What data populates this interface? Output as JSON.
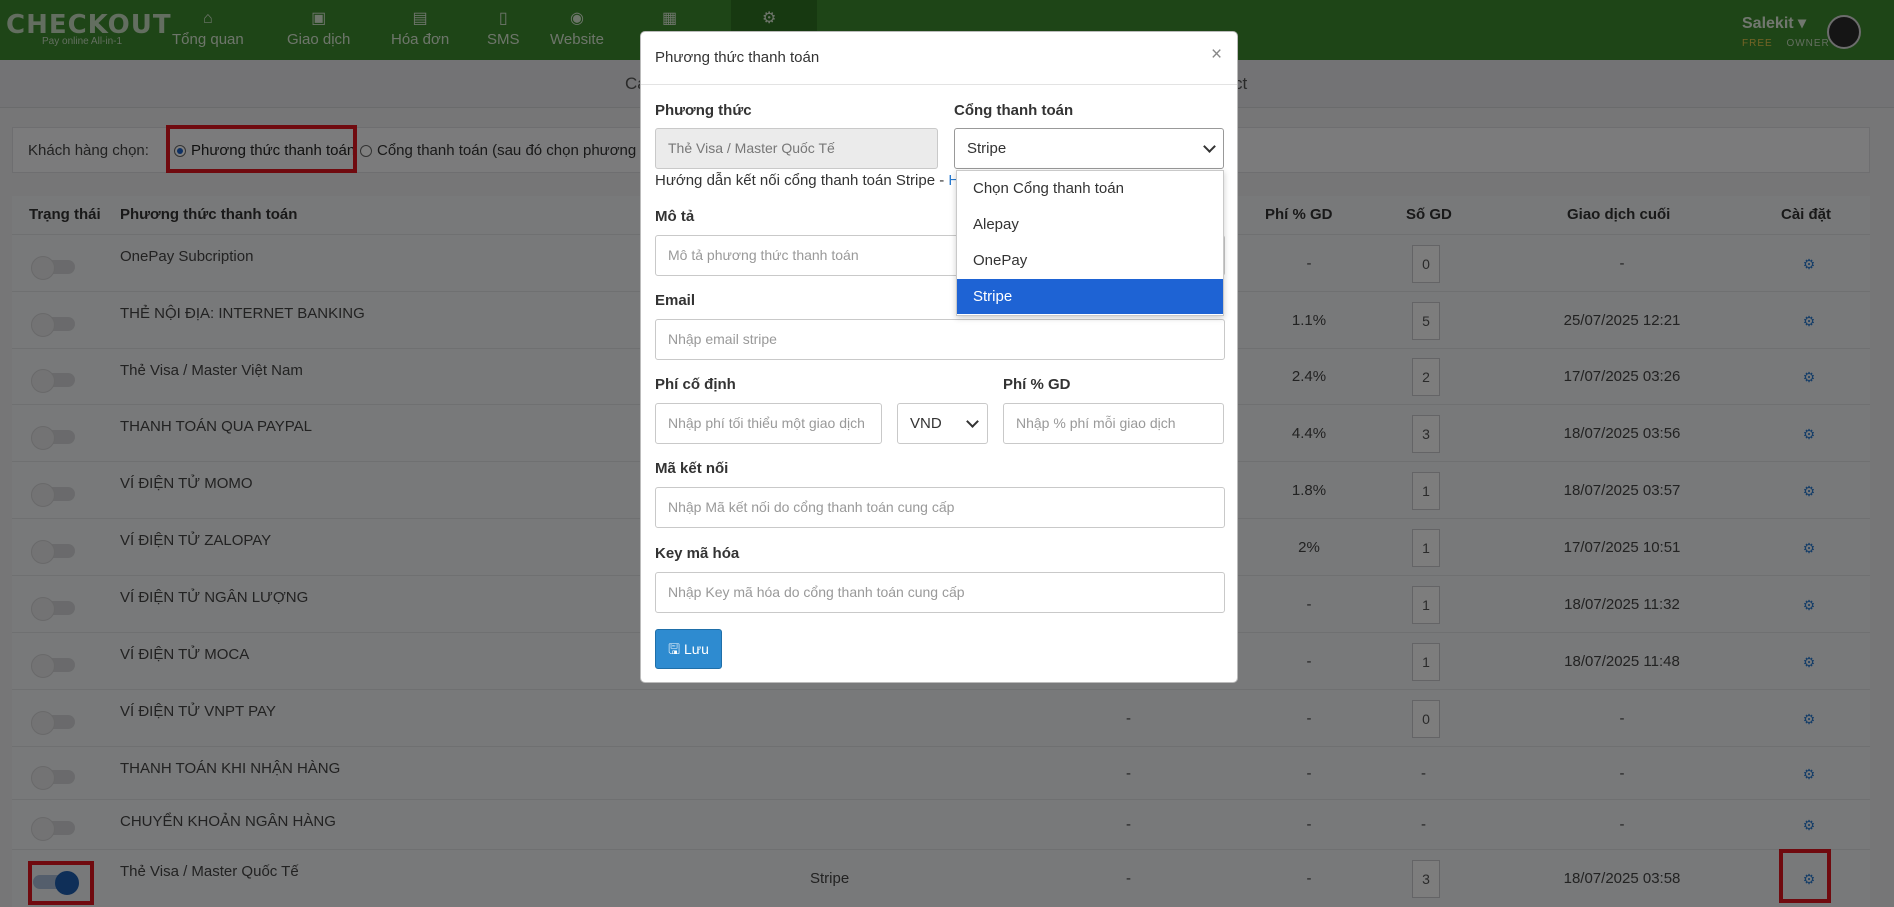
{
  "brand": {
    "name": "CHECKOUT",
    "tagline": "Pay online All-in-1"
  },
  "nav": [
    {
      "label": "Tổng quan",
      "icon": "home-icon",
      "glyph": "⌂"
    },
    {
      "label": "Giao dịch",
      "icon": "money-icon",
      "glyph": "▣"
    },
    {
      "label": "Hóa đơn",
      "icon": "document-icon",
      "glyph": "▤"
    },
    {
      "label": "SMS",
      "icon": "mobile-icon",
      "glyph": "▯"
    },
    {
      "label": "Website",
      "icon": "globe-icon",
      "glyph": "◉"
    },
    {
      "label": "",
      "icon": "calendar-icon",
      "glyph": "▦"
    },
    {
      "label": "",
      "icon": "gear-icon",
      "glyph": "⚙"
    }
  ],
  "user": {
    "name": "Salekit ▾",
    "plan": "FREE",
    "role": "OWNER"
  },
  "subbar": {
    "left": "Ca",
    "right": "ct"
  },
  "filter": {
    "label": "Khách hàng chọn:",
    "option1": "Phương thức thanh toán",
    "option2": "Cổng thanh toán (sau đó chọn phương th"
  },
  "table": {
    "headers": {
      "status": "Trạng thái",
      "method": "Phương thức thanh toán",
      "fee_pct": "Phí % GD",
      "count": "Số GD",
      "last": "Giao dịch cuối",
      "settings": "Cài đặt"
    },
    "rows": [
      {
        "name": "OnePay Subcription",
        "gateway": "",
        "fixed": "",
        "fee": "-",
        "count": "0",
        "last": "-",
        "on": false
      },
      {
        "name": "THẺ NỘI ĐỊA: INTERNET BANKING",
        "gateway": "",
        "fixed": "",
        "fee": "1.1%",
        "count": "5",
        "last": "25/07/2025 12:21",
        "on": false
      },
      {
        "name": "Thẻ Visa / Master Việt Nam",
        "gateway": "",
        "fixed": "",
        "fee": "2.4%",
        "count": "2",
        "last": "17/07/2025 03:26",
        "on": false
      },
      {
        "name": "THANH TOÁN QUA PAYPAL",
        "gateway": "",
        "fixed": "",
        "fee": "4.4%",
        "count": "3",
        "last": "18/07/2025 03:56",
        "on": false
      },
      {
        "name": "VÍ ĐIỆN TỬ MOMO",
        "gateway": "",
        "fixed": "",
        "fee": "1.8%",
        "count": "1",
        "last": "18/07/2025 03:57",
        "on": false
      },
      {
        "name": "VÍ ĐIỆN TỬ ZALOPAY",
        "gateway": "",
        "fixed": "",
        "fee": "2%",
        "count": "1",
        "last": "17/07/2025 10:51",
        "on": false
      },
      {
        "name": "VÍ ĐIỆN TỬ NGÂN LƯỢNG",
        "gateway": "",
        "fixed": "",
        "fee": "-",
        "count": "1",
        "last": "18/07/2025 11:32",
        "on": false
      },
      {
        "name": "VÍ ĐIỆN TỬ MOCA",
        "gateway": "",
        "fixed": "",
        "fee": "-",
        "count": "1",
        "last": "18/07/2025 11:48",
        "on": false
      },
      {
        "name": "VÍ ĐIỆN TỬ VNPT PAY",
        "gateway": "",
        "fixed": "-",
        "fee": "-",
        "count": "0",
        "last": "-",
        "on": false
      },
      {
        "name": "THANH TOÁN KHI NHẬN HÀNG",
        "gateway": "",
        "fixed": "-",
        "fee": "-",
        "count": "-",
        "last": "-",
        "on": false
      },
      {
        "name": "CHUYỂN KHOẢN NGÂN HÀNG",
        "gateway": "",
        "fixed": "-",
        "fee": "-",
        "count": "-",
        "last": "-",
        "on": false
      },
      {
        "name": "Thẻ Visa / Master Quốc Tế",
        "gateway": "Stripe",
        "fixed": "-",
        "fee": "-",
        "count": "3",
        "last": "18/07/2025 03:58",
        "on": true
      }
    ]
  },
  "modal": {
    "title": "Phương thức thanh toán",
    "close": "×",
    "method_label": "Phương thức",
    "method_value": "Thẻ Visa / Master Quốc Tế",
    "gateway_label": "Cổng thanh toán",
    "gateway_value": "Stripe",
    "hint": "Hướng dẫn kết nối cổng thanh toán Stripe - ",
    "hint_link": "Hư",
    "gateway_options": [
      "Chọn Cổng thanh toán",
      "Alepay",
      "OnePay",
      "Stripe"
    ],
    "desc_label": "Mô tả",
    "desc_placeholder": "Mô tả phương thức thanh toán",
    "email_label": "Email",
    "email_placeholder": "Nhập email stripe",
    "fixed_label": "Phí cố định",
    "fixed_placeholder": "Nhập phí tối thiểu một giao dịch",
    "currency": "VND",
    "pct_label": "Phí % GD",
    "pct_placeholder": "Nhập % phí mỗi giao dịch",
    "connect_label": "Mã kết nối",
    "connect_placeholder": "Nhập Mã kết nối do cổng thanh toán cung cấp",
    "key_label": "Key mã hóa",
    "key_placeholder": "Nhập Key mã hóa do cổng thanh toán cung cấp",
    "save_label": "Lưu",
    "save_icon": "🖫"
  }
}
